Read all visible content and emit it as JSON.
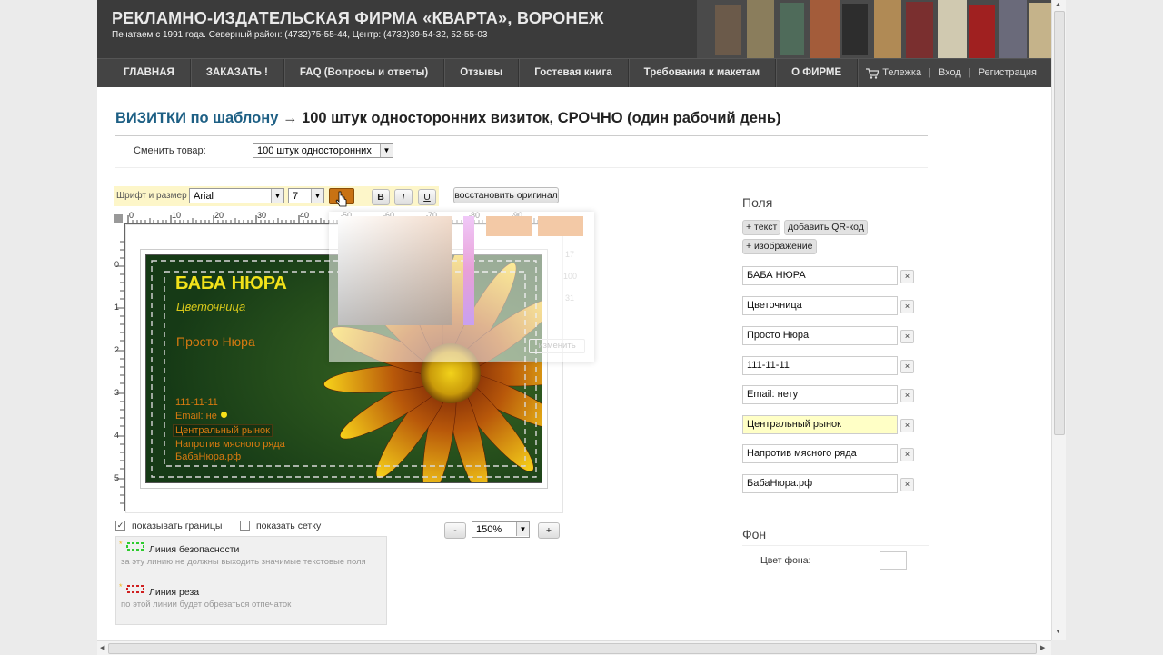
{
  "header": {
    "title": "РЕКЛАМНО-ИЗДАТЕЛЬСКАЯ ФИРМА «КВАРТА», ВОРОНЕЖ",
    "subtitle": "Печатаем с 1991 года. Северный район: (4732)75-55-44, Центр: (4732)39-54-32, 52-55-03"
  },
  "nav": {
    "items": [
      "ГЛАВНАЯ",
      "ЗАКАЗАТЬ !",
      "FAQ (Вопросы и ответы)",
      "Отзывы",
      "Гостевая книга",
      "Требования к макетам",
      "О ФИРМЕ"
    ],
    "cart": "Тележка",
    "login": "Вход",
    "register": "Регистрация"
  },
  "page": {
    "heading_link": "ВИЗИТКИ по шаблону",
    "heading_rest": " → 100 штук односторонних визиток, СРОЧНО (один рабочий день)",
    "change_label": "Сменить товар:",
    "change_value": "100 штук односторонних"
  },
  "toolbar": {
    "label": "Шрифт и размер",
    "font": "Arial",
    "size": "7",
    "bold": "B",
    "italic": "I",
    "underline": "U",
    "restore": "восстановить оригинал",
    "color": "#c87214"
  },
  "ruler": {
    "h": [
      "0",
      "10",
      "20",
      "30",
      "40",
      "50",
      "60",
      "70",
      "80",
      "90"
    ],
    "v": [
      "0",
      "1",
      "2",
      "3",
      "4",
      "5"
    ]
  },
  "card": {
    "name": "БАБА НЮРА",
    "subtitle": "Цветочница",
    "nickname": "Просто Нюра",
    "phone": "111-11-11",
    "email": "Email: не",
    "market": "Центральный рынок",
    "place": "Напротив мясного ряда",
    "site": "БабаНюра.рф"
  },
  "overlay": {
    "button": "изменить",
    "nums": [
      "17",
      "100",
      "31"
    ]
  },
  "canvas": {
    "show_borders": "показывать границы",
    "show_grid": "показать сетку",
    "zoom": "150%",
    "minus": "-",
    "plus": "+"
  },
  "legend": {
    "safety_title": "Линия безопасности",
    "safety_desc": "за эту линию не должны выходить значимые текстовые поля",
    "cut_title": "Линия реза",
    "cut_desc": "по этой линии будет обрезаться отпечаток"
  },
  "fields": {
    "title": "Поля",
    "add_text": "+ текст",
    "add_qr": "добавить QR-код",
    "add_image": "+ изображение",
    "items": [
      "БАБА НЮРА",
      "Цветочница",
      "Просто Нюра",
      "111-11-11",
      "Email: нету",
      "Центральный рынок",
      "Напротив мясного ряда",
      "БабаНюра.рф"
    ],
    "x": "×"
  },
  "background": {
    "title": "Фон",
    "color_label": "Цвет фона:"
  }
}
